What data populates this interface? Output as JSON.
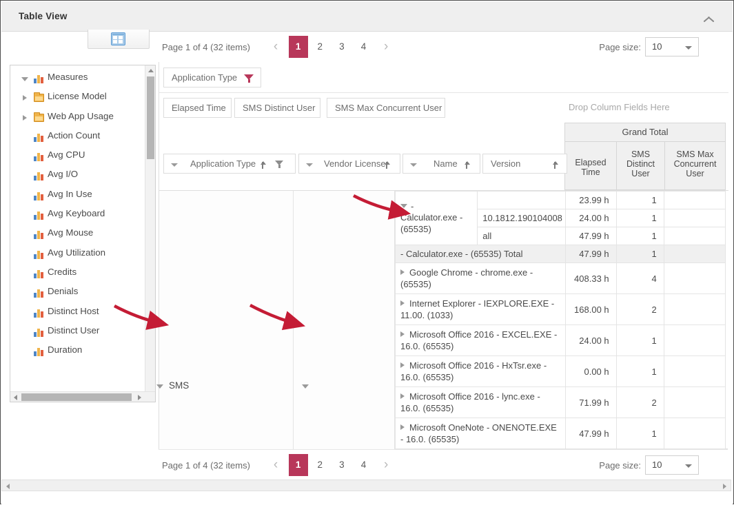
{
  "window": {
    "title": "Table View",
    "collapse_icon": "chevron-up-icon"
  },
  "toolbar": {
    "grid_icon": "grid-view-icon"
  },
  "pager": {
    "status": "Page 1 of 4 (32 items)",
    "prev_icon": "‹",
    "next_icon": "›",
    "pages": [
      "1",
      "2",
      "3",
      "4"
    ],
    "selected_page": "1",
    "page_size_label": "Page size:",
    "page_size_value": "10",
    "accent_color": "#b8375a"
  },
  "tree": {
    "items": [
      {
        "label": "Measures",
        "icon": "measure-icon",
        "twisty": "open",
        "indent": 0
      },
      {
        "label": "License Model",
        "icon": "folder-icon",
        "twisty": "closed",
        "indent": 0
      },
      {
        "label": "Web App Usage",
        "icon": "folder-icon",
        "twisty": "closed",
        "indent": 0
      },
      {
        "label": "Action Count",
        "icon": "measure-icon",
        "twisty": "none",
        "indent": 0
      },
      {
        "label": "Avg CPU",
        "icon": "measure-icon",
        "twisty": "none",
        "indent": 0
      },
      {
        "label": "Avg I/O",
        "icon": "measure-icon",
        "twisty": "none",
        "indent": 0
      },
      {
        "label": "Avg In Use",
        "icon": "measure-icon",
        "twisty": "none",
        "indent": 0
      },
      {
        "label": "Avg Keyboard",
        "icon": "measure-icon",
        "twisty": "none",
        "indent": 0
      },
      {
        "label": "Avg Mouse",
        "icon": "measure-icon",
        "twisty": "none",
        "indent": 0
      },
      {
        "label": "Avg Utilization",
        "icon": "measure-icon",
        "twisty": "none",
        "indent": 0
      },
      {
        "label": "Credits",
        "icon": "measure-icon",
        "twisty": "none",
        "indent": 0
      },
      {
        "label": "Denials",
        "icon": "measure-icon",
        "twisty": "none",
        "indent": 0
      },
      {
        "label": "Distinct Host",
        "icon": "measure-icon",
        "twisty": "none",
        "indent": 0
      },
      {
        "label": "Distinct User",
        "icon": "measure-icon",
        "twisty": "none",
        "indent": 0
      },
      {
        "label": "Duration",
        "icon": "measure-icon",
        "twisty": "none",
        "indent": 0
      }
    ]
  },
  "pivot": {
    "filter_chip": {
      "label": "Application Type",
      "icon": "filter-funnel-icon"
    },
    "value_chips": [
      {
        "label": "Elapsed Time"
      },
      {
        "label": "SMS Distinct User"
      },
      {
        "label": "SMS Max Concurrent User"
      }
    ],
    "drop_column_hint": "Drop Column Fields Here",
    "column_group": {
      "title": "Grand Total",
      "measures": [
        "Elapsed Time",
        "SMS Distinct User",
        "SMS Max Concurrent User"
      ]
    },
    "row_fields": [
      {
        "label": "Application Type",
        "sorted": true,
        "filtered": true
      },
      {
        "label": "Vendor License",
        "sorted": true,
        "filtered": false
      },
      {
        "label": "Name",
        "sorted": true,
        "filtered": false
      },
      {
        "label": "Version",
        "sorted": true,
        "filtered": false
      }
    ],
    "row_group_level1": "SMS"
  },
  "chart_data": {
    "type": "table",
    "title": "Grand Total",
    "columns": [
      "Name",
      "Version",
      "Elapsed Time",
      "SMS Distinct User",
      "SMS Max Concurrent User"
    ],
    "rows": [
      {
        "name": "",
        "version": "",
        "elapsed": "23.99 h",
        "distinct": "1",
        "maxconc": "",
        "kind": "detail",
        "expanded": null
      },
      {
        "name": "- Calculator.exe - (65535)",
        "version": "10.1812.190104008",
        "elapsed": "24.00 h",
        "distinct": "1",
        "maxconc": "",
        "kind": "detail",
        "expanded": true
      },
      {
        "name": "",
        "version": "all",
        "elapsed": "47.99 h",
        "distinct": "1",
        "maxconc": "",
        "kind": "detail",
        "expanded": null
      },
      {
        "name": "- Calculator.exe - (65535) Total",
        "version": "",
        "elapsed": "47.99 h",
        "distinct": "1",
        "maxconc": "",
        "kind": "total",
        "expanded": null
      },
      {
        "name": "Google Chrome - chrome.exe - (65535)",
        "version": "",
        "elapsed": "408.33 h",
        "distinct": "4",
        "maxconc": "",
        "kind": "group",
        "expanded": false
      },
      {
        "name": "Internet Explorer - IEXPLORE.EXE - 11.00. (1033)",
        "version": "",
        "elapsed": "168.00 h",
        "distinct": "2",
        "maxconc": "",
        "kind": "group",
        "expanded": false
      },
      {
        "name": "Microsoft Office 2016 - EXCEL.EXE - 16.0. (65535)",
        "version": "",
        "elapsed": "24.00 h",
        "distinct": "1",
        "maxconc": "",
        "kind": "group",
        "expanded": false
      },
      {
        "name": "Microsoft Office 2016 - HxTsr.exe - 16.0. (65535)",
        "version": "",
        "elapsed": "0.00 h",
        "distinct": "1",
        "maxconc": "",
        "kind": "group",
        "expanded": false
      },
      {
        "name": "Microsoft Office 2016 - lync.exe - 16.0. (65535)",
        "version": "",
        "elapsed": "71.99 h",
        "distinct": "2",
        "maxconc": "",
        "kind": "group",
        "expanded": false
      },
      {
        "name": "Microsoft OneNote - ONENOTE.EXE - 16.0. (65535)",
        "version": "",
        "elapsed": "47.99 h",
        "distinct": "1",
        "maxconc": "",
        "kind": "group",
        "expanded": false
      }
    ]
  }
}
